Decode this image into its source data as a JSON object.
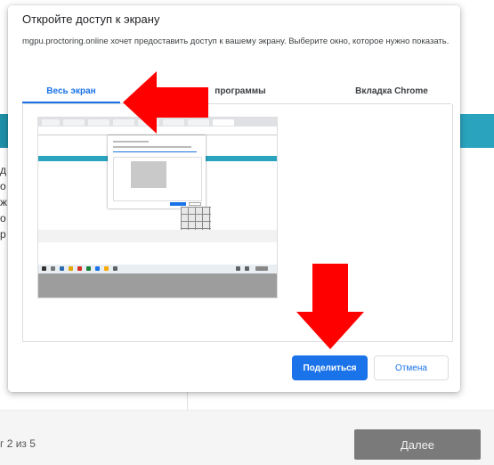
{
  "background": {
    "left_letters": [
      "д",
      "о",
      "ж",
      "о",
      "р"
    ],
    "step_text": "г 2 из 5",
    "next_button": "Далее",
    "teal_color": "#2aa4be"
  },
  "dialog": {
    "title": "Откройте доступ к экрану",
    "description": "mgpu.proctoring.online хочет предоставить доступ к вашему экрану. Выберите окно, которое нужно показать.",
    "tabs": [
      {
        "label": "Весь экран",
        "active": true
      },
      {
        "label": "программы",
        "active": false
      },
      {
        "label": "Вкладка Chrome",
        "active": false
      }
    ],
    "share_button": "Поделиться",
    "cancel_button": "Отмена",
    "accent_color": "#1a73e8"
  },
  "annotations": {
    "arrow_color": "#ff0000",
    "icons": [
      "red-arrow-left-icon",
      "red-arrow-down-icon"
    ]
  }
}
